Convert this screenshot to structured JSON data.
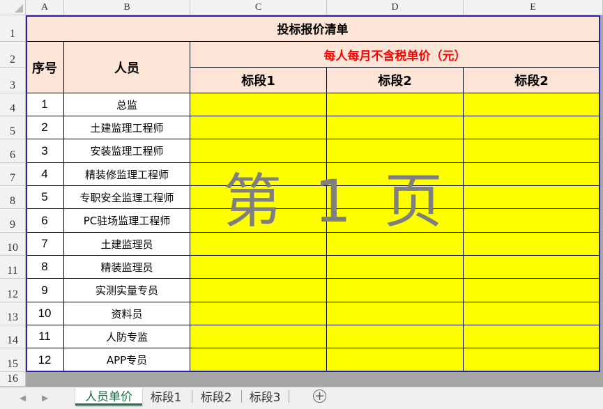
{
  "columns": [
    "A",
    "B",
    "C",
    "D",
    "E"
  ],
  "rows": [
    "1",
    "2",
    "3",
    "4",
    "5",
    "6",
    "7",
    "8",
    "9",
    "10",
    "11",
    "12",
    "13",
    "14",
    "15",
    "16"
  ],
  "sheet": {
    "title": "投标报价清单",
    "header_seq": "序号",
    "header_person": "人员",
    "header_price": "每人每月不含税单价（元）",
    "sections": [
      "标段1",
      "标段2",
      "标段2"
    ],
    "items": [
      {
        "seq": "1",
        "person": "总监"
      },
      {
        "seq": "2",
        "person": "土建监理工程师"
      },
      {
        "seq": "3",
        "person": "安装监理工程师"
      },
      {
        "seq": "4",
        "person": "精装修监理工程师"
      },
      {
        "seq": "5",
        "person": "专职安全监理工程师"
      },
      {
        "seq": "6",
        "person": "PC驻场监理工程师"
      },
      {
        "seq": "7",
        "person": "土建监理员"
      },
      {
        "seq": "8",
        "person": "精装监理员"
      },
      {
        "seq": "9",
        "person": "实测实量专员"
      },
      {
        "seq": "10",
        "person": "资料员"
      },
      {
        "seq": "11",
        "person": "人防专监"
      },
      {
        "seq": "12",
        "person": "APP专员"
      }
    ]
  },
  "watermark": "第 1 页",
  "tabs": {
    "sheets": [
      "人员单价",
      "标段1",
      "标段2",
      "标段3"
    ],
    "active": "人员单价",
    "add_icon": "plus-circle-icon",
    "prev_icon": "triangle-left-icon",
    "next_icon": "triangle-right-icon"
  },
  "colors": {
    "header_fill": "#fce4d6",
    "input_fill": "#ffff00",
    "emphasis_text": "#ff0000",
    "active_tab": "#217346",
    "outline": "#2222aa"
  }
}
